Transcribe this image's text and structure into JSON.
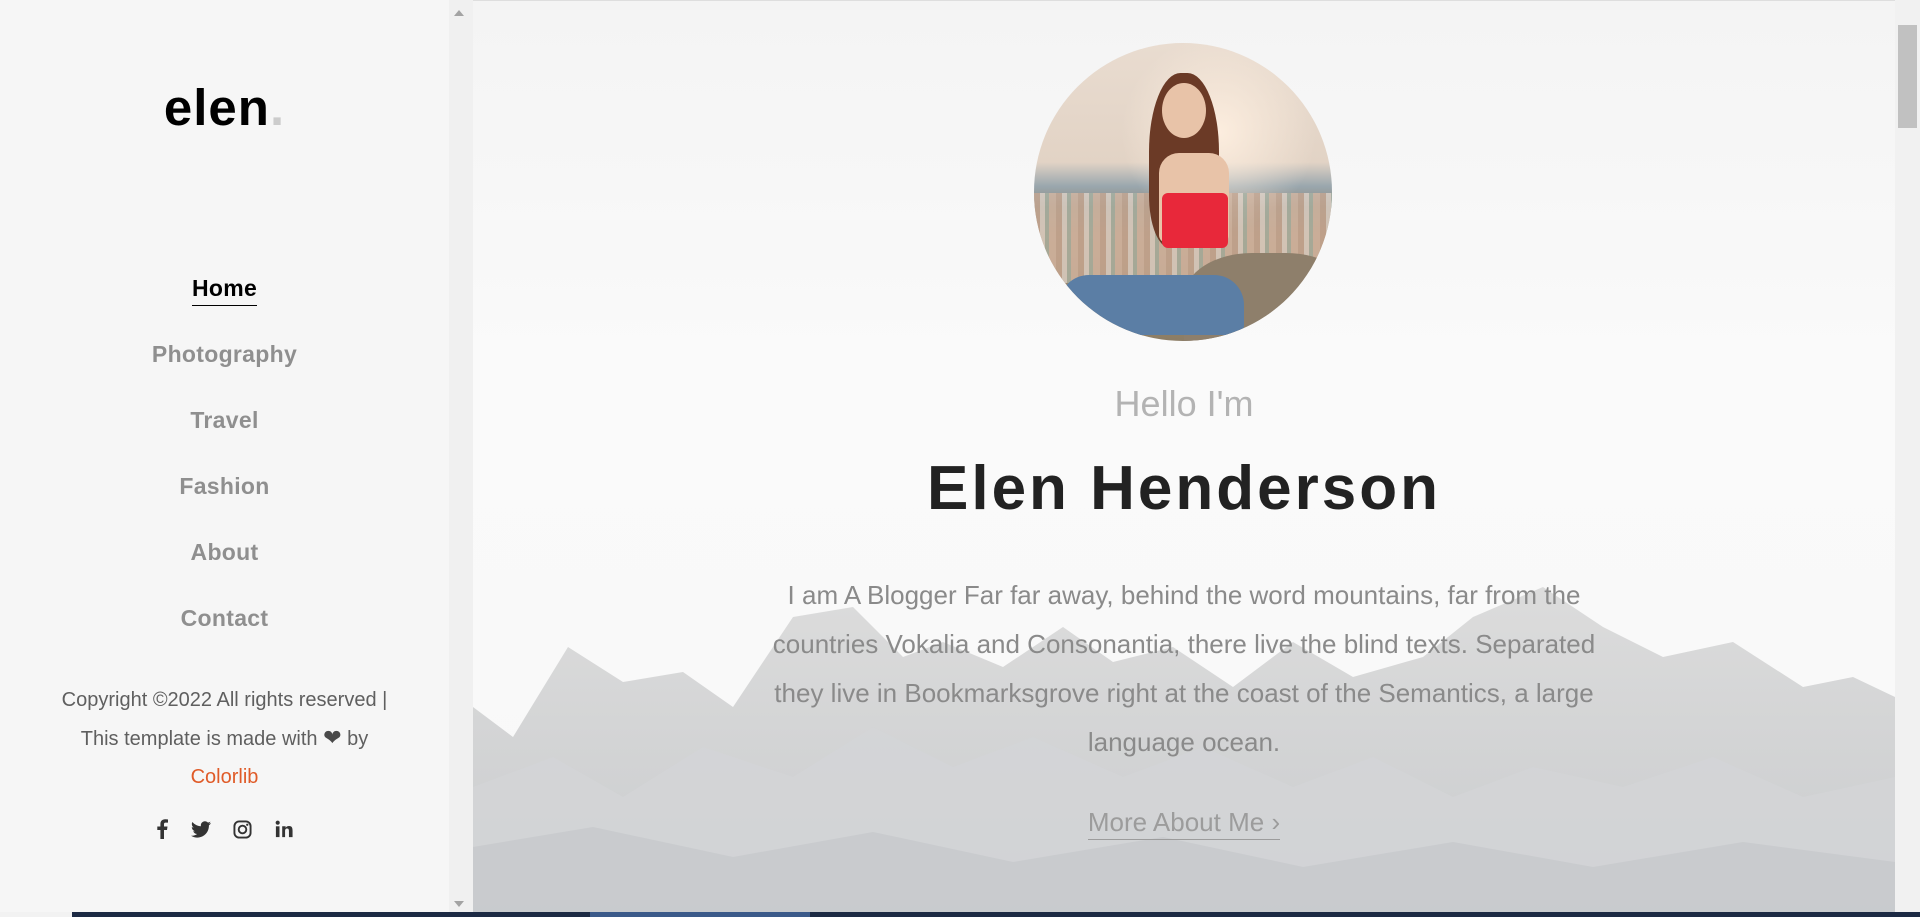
{
  "sidebar": {
    "logo": "elen",
    "logo_dot": ".",
    "nav": [
      {
        "label": "Home",
        "active": true
      },
      {
        "label": "Photography",
        "active": false
      },
      {
        "label": "Travel",
        "active": false
      },
      {
        "label": "Fashion",
        "active": false
      },
      {
        "label": "About",
        "active": false
      },
      {
        "label": "Contact",
        "active": false
      }
    ],
    "copyright": {
      "prefix": "Copyright ©2022 All rights reserved | This template is made with",
      "heart_icon": "heart-icon",
      "by": "by",
      "brand": "Colorlib"
    },
    "social_icons": [
      "facebook-icon",
      "twitter-icon",
      "instagram-icon",
      "linkedin-icon"
    ]
  },
  "hero": {
    "greeting": "Hello I'm",
    "name": "Elen Henderson",
    "bio": "I am A Blogger Far far away, behind the word mountains, far from the countries Vokalia and Consonantia, there live the blind texts. Separated they live in Bookmarksgrove right at the coast of the Semantics, a large language ocean.",
    "cta": "More About Me",
    "cta_icon": "chevron-right-icon"
  },
  "colors": {
    "accent": "#e05b28",
    "nav_active": "#000000",
    "nav_inactive": "#8f8f8f",
    "sidebar_bg": "#f6f6f6"
  }
}
